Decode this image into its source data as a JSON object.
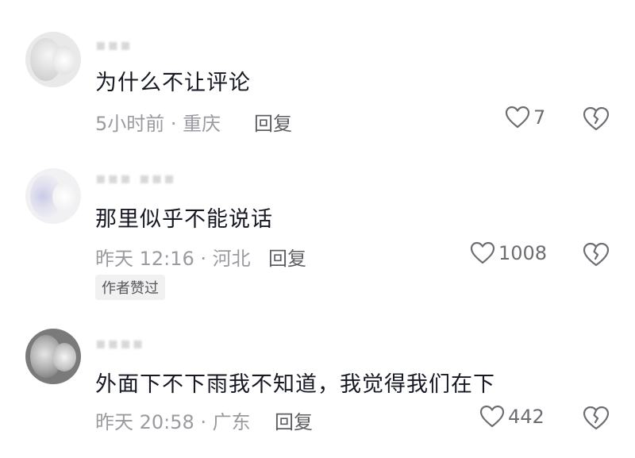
{
  "comments": [
    {
      "username": "▪▪▪",
      "text": "为什么不让评论",
      "meta": "5小时前 · 重庆",
      "reply": "回复",
      "likes": "7"
    },
    {
      "username": "▪▪▪ ▪▪▪",
      "text": "那里似乎不能说话",
      "meta": "昨天 12:16 · 河北",
      "reply": "回复",
      "likes": "1008",
      "badge": "作者赞过"
    },
    {
      "username": "▪▪▪▪",
      "text": "外面下不下雨我不知道，我觉得我们在下",
      "meta": "昨天 20:58 · 广东",
      "reply": "回复",
      "likes": "442"
    }
  ],
  "icons": {
    "like": "heart-outline-icon",
    "dislike": "broken-heart-icon"
  },
  "colors": {
    "text": "#161823",
    "meta": "#9a9ba0",
    "icon": "#6c6d72"
  }
}
